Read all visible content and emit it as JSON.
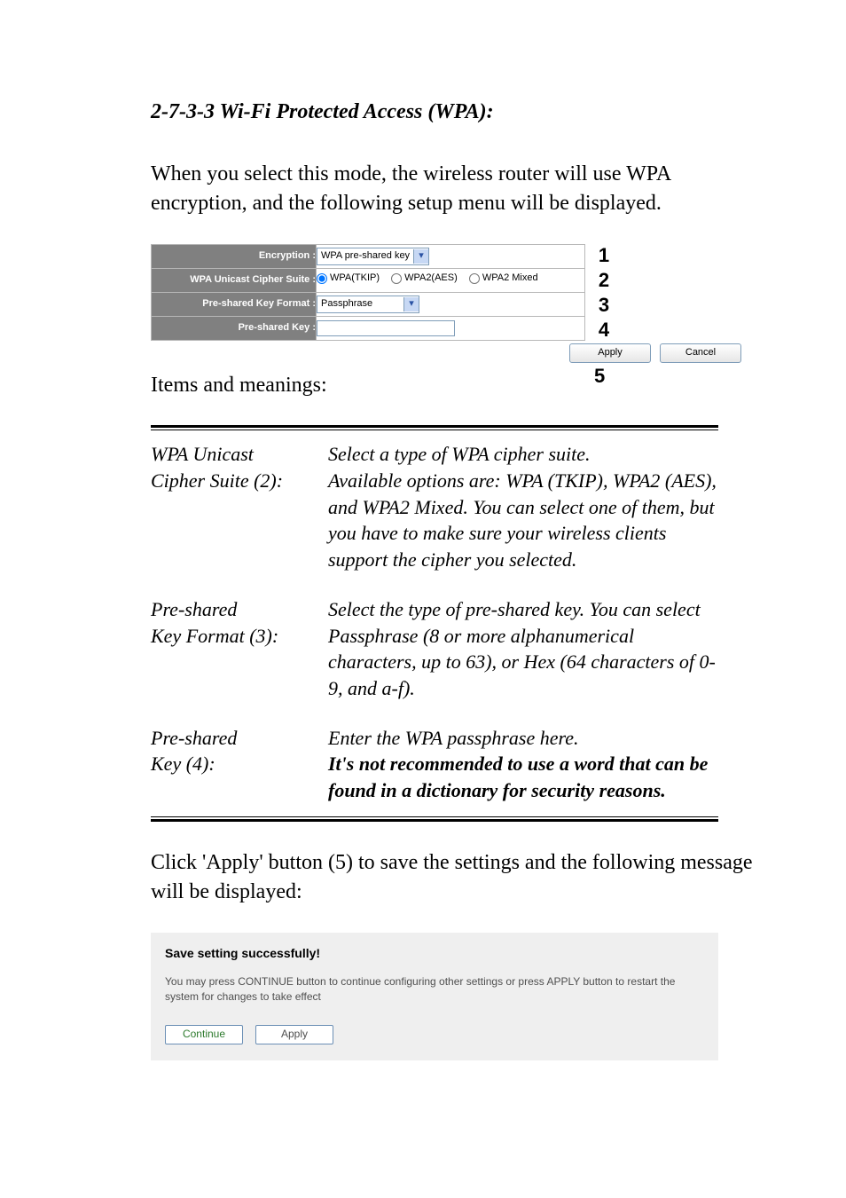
{
  "doc": {
    "heading": "2-7-3-3 Wi-Fi Protected Access (WPA):",
    "intro": "When you select this mode, the wireless router will use WPA encryption, and the following setup menu will be displayed.",
    "items_label": "Items and meanings:",
    "apply_note": "Click 'Apply' button (5) to save the settings and the following message will be displayed:"
  },
  "wpa_form": {
    "rows": {
      "encryption_label": "Encryption :",
      "encryption_value": "WPA pre-shared key",
      "cipher_label": "WPA Unicast Cipher Suite :",
      "cipher_options": [
        "WPA(TKIP)",
        "WPA2(AES)",
        "WPA2 Mixed"
      ],
      "cipher_selected_index": 0,
      "keyformat_label": "Pre-shared Key Format :",
      "keyformat_value": "Passphrase",
      "key_label": "Pre-shared Key :",
      "key_value": ""
    },
    "numbers": [
      "1",
      "2",
      "3",
      "4"
    ],
    "apply_btn": "Apply",
    "cancel_btn": "Cancel",
    "number5": "5"
  },
  "items": [
    {
      "term": "WPA Unicast\nCipher Suite (2):",
      "desc": "Select a type of WPA cipher suite.\nAvailable options are: WPA (TKIP), WPA2 (AES), and WPA2 Mixed. You can select one of them, but you have to make sure your wireless clients support the cipher you selected.",
      "desc_bold": ""
    },
    {
      "term": "Pre-shared\nKey Format (3):",
      "desc": "Select the type of pre-shared key. You can select Passphrase (8 or more alphanumerical characters, up to 63), or Hex (64 characters of 0-9, and a-f).",
      "desc_bold": ""
    },
    {
      "term": "Pre-shared\nKey (4):",
      "desc": "Enter the WPA passphrase here.",
      "desc_bold": "It's not recommended to use a word that can be found in a dictionary for security reasons."
    }
  ],
  "save_panel": {
    "title": "Save setting successfully!",
    "msg": "You may press CONTINUE button to continue configuring other settings or press APPLY button to restart the system for changes to take effect",
    "continue_btn": "Continue",
    "apply_btn": "Apply"
  }
}
